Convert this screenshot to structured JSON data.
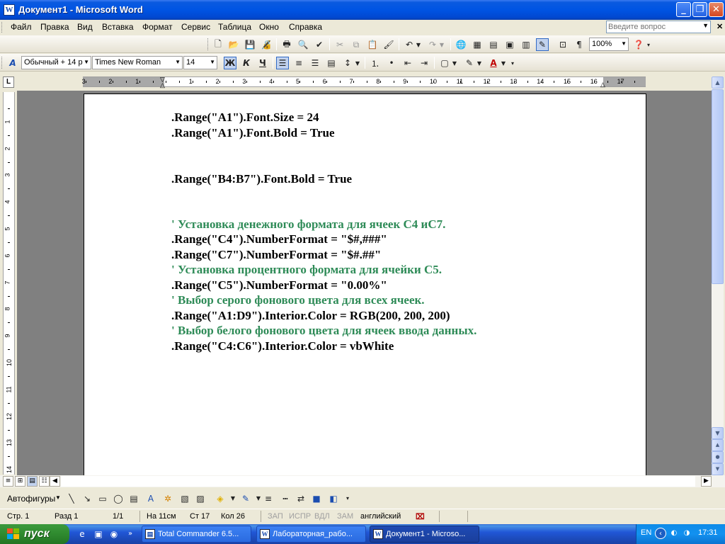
{
  "window": {
    "title": "Документ1 - Microsoft Word",
    "app_icon": "word-icon"
  },
  "menu": {
    "items": [
      "Файл",
      "Правка",
      "Вид",
      "Вставка",
      "Формат",
      "Сервис",
      "Таблица",
      "Окно",
      "Справка"
    ],
    "help_placeholder": "Введите вопрос"
  },
  "standard_toolbar": {
    "zoom": "100%"
  },
  "formatting_toolbar": {
    "style": "Обычный + 14 р",
    "font": "Times New Roman",
    "size": "14",
    "bold_label": "Ж",
    "italic_label": "К",
    "underline_label": "Ч"
  },
  "ruler": {
    "h_labels": [
      "3",
      "2",
      "1",
      "1",
      "2",
      "3",
      "4",
      "5",
      "6",
      "7",
      "8",
      "9",
      "10",
      "11",
      "12",
      "13",
      "14",
      "15",
      "16",
      "17"
    ],
    "v_labels": [
      "1",
      "2",
      "3",
      "4",
      "5",
      "6",
      "7",
      "8",
      "9",
      "10",
      "11",
      "12",
      "13",
      "14"
    ]
  },
  "document": {
    "lines": [
      {
        "text": ".Range(\"A1\").Font.Size = 24",
        "kind": "code"
      },
      {
        "text": ".Range(\"A1\").Font.Bold = True",
        "kind": "code"
      },
      {
        "text": ".Range(\"B4:B7\").Font.Bold = True",
        "kind": "code"
      },
      {
        "text": "' Установка денежного формата для ячеек С4 иС7.",
        "kind": "comment"
      },
      {
        "text": ".Range(\"C4\").NumberFormat = \"$#,###\"",
        "kind": "code"
      },
      {
        "text": ".Range(\"C7\").NumberFormat = \"$#.##\"",
        "kind": "code"
      },
      {
        "text": "' Установка процентного формата для ячейки С5.",
        "kind": "comment"
      },
      {
        "text": ".Range(\"C5\").NumberFormat = \"0.00%\"",
        "kind": "code"
      },
      {
        "text": "' Выбор серого фонового цвета для всех ячеек.",
        "kind": "comment"
      },
      {
        "text": ".Range(\"A1:D9\").Interior.Color = RGB(200, 200, 200)",
        "kind": "code"
      },
      {
        "text": "' Выбор белого фонового цвета для  ячеек ввода данных.",
        "kind": "comment"
      },
      {
        "text": ".Range(\"C4:C6\").Interior.Color = vbWhite",
        "kind": "code"
      }
    ],
    "colors": {
      "code": "#000000",
      "comment": "#2e8b57"
    }
  },
  "drawing_toolbar": {
    "autoshapes": "Автофигуры"
  },
  "statusbar": {
    "page": "Стр. 1",
    "section": "Разд 1",
    "pages": "1/1",
    "position": "На 11см",
    "line": "Ст 17",
    "column": "Кол 26",
    "rec": "ЗАП",
    "trk": "ИСПР",
    "ext": "ВДЛ",
    "ovr": "ЗАМ",
    "language": "английский"
  },
  "taskbar": {
    "start": "пуск",
    "tasks": [
      "Total Commander 6.5...",
      "Лабораторная_рабо...",
      "Документ1 - Microso..."
    ],
    "lang": "EN",
    "clock": "17:31"
  }
}
